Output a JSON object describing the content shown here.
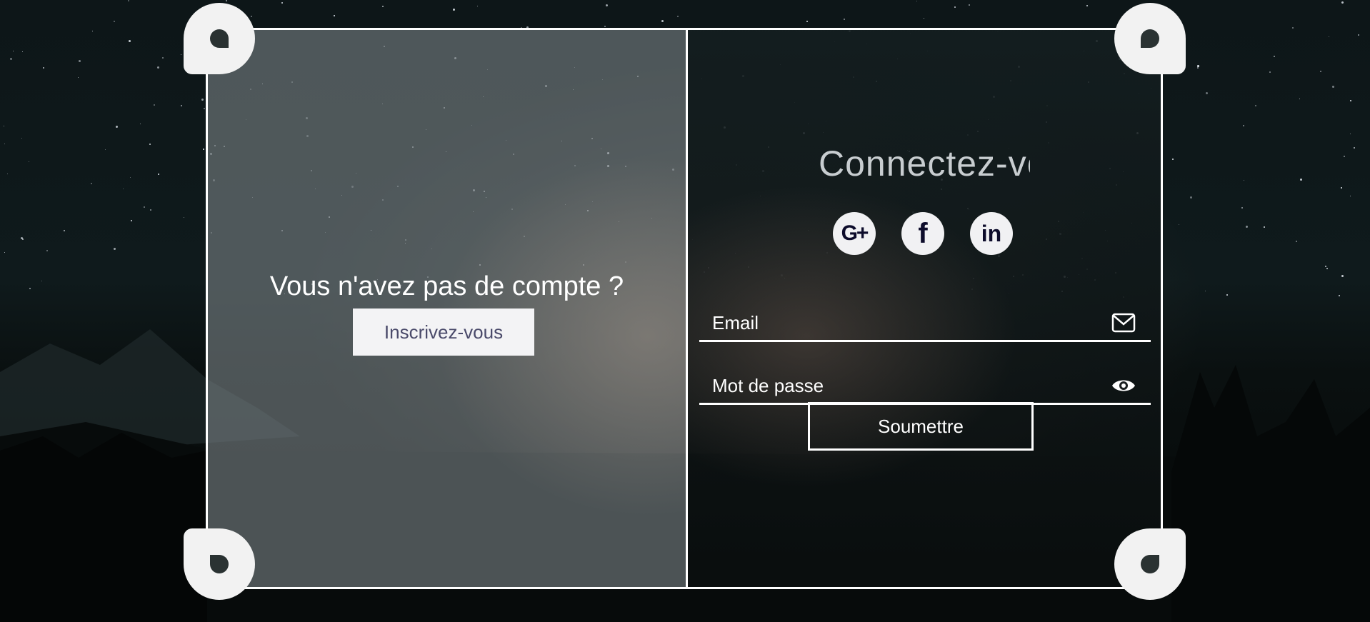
{
  "left": {
    "prompt": "Vous n'avez pas de compte ?",
    "signup_label": "Inscrivez-vous"
  },
  "right": {
    "title": "Connectez-vous",
    "socials": [
      {
        "icon": "google-plus-icon",
        "glyph": "G+"
      },
      {
        "icon": "facebook-icon",
        "glyph": "f"
      },
      {
        "icon": "linkedin-icon",
        "glyph": "in"
      }
    ],
    "email_placeholder": "Email",
    "password_placeholder": "Mot de passe",
    "submit_label": "Soumettre"
  },
  "colors": {
    "accent_dark": "#0d0c2b",
    "button_bg": "#f3f3f5",
    "border": "#ffffff"
  }
}
